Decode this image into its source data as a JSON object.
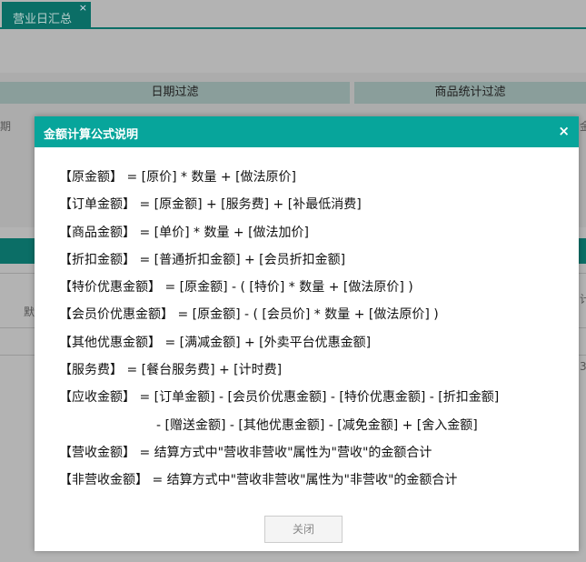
{
  "tabs": [
    {
      "label": "营业日汇总",
      "close": "×"
    }
  ],
  "panels": {
    "date_filter": "日期过滤",
    "goods_filter": "商品统计过滤"
  },
  "fragments": {
    "left1": "期",
    "left2": "默",
    "right1": "金",
    "right2": "计",
    "right3": "3"
  },
  "dialog": {
    "title": "金额计算公式说明",
    "close_icon": "×",
    "lines": [
      "【原金额】 = [原价] * 数量 + [做法原价]",
      "【订单金额】 = [原金额] + [服务费] + [补最低消费]",
      "【商品金额】 = [单价] * 数量 + [做法加价]",
      "【折扣金额】 = [普通折扣金额] + [会员折扣金额]",
      "【特价优惠金额】 = [原金额] - ( [特价] * 数量 + [做法原价] )",
      "【会员价优惠金额】 = [原金额] - ( [会员价] * 数量 + [做法原价] )",
      "【其他优惠金额】 = [满减金额] + [外卖平台优惠金额]",
      "【服务费】 = [餐台服务费] + [计时费]",
      "【应收金额】 = [订单金额] - [会员价优惠金额] - [特价优惠金额] - [折扣金额]",
      "- [赠送金额] - [其他优惠金额] - [减免金额] + [舍入金额]",
      "【营收金额】 = 结算方式中\"营收非营收\"属性为\"营收\"的金额合计",
      "【非营收金额】 = 结算方式中\"营收非营收\"属性为\"非营收\"的金额合计"
    ],
    "close_button": "关闭"
  },
  "colors": {
    "header": "#07a59b",
    "tab": "#0b6e66"
  }
}
